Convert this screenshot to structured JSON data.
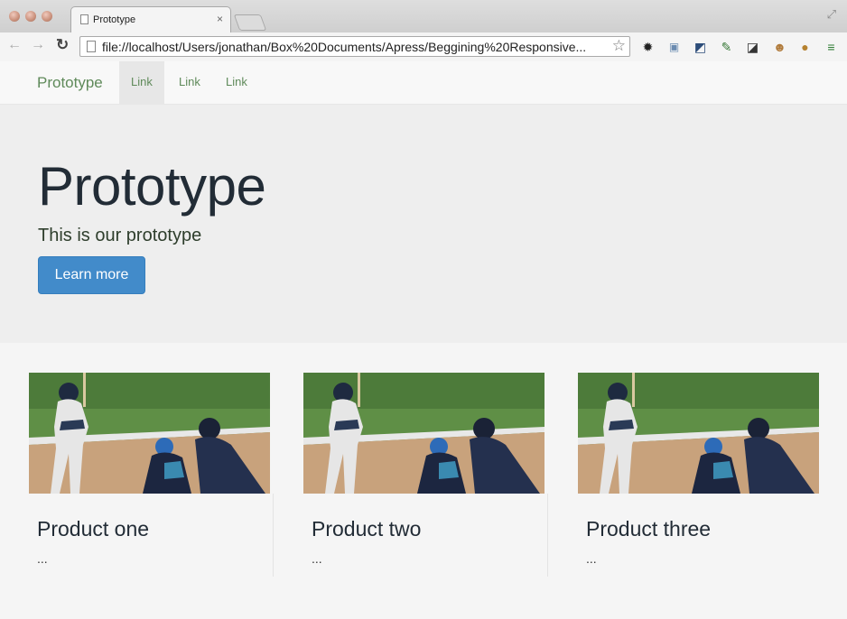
{
  "browser": {
    "tab_title": "Prototype",
    "tab_close": "×",
    "url": "file://localhost/Users/jonathan/Box%20Documents/Apress/Beggining%20Responsive...",
    "icons": [
      "back-arrow-icon",
      "forward-arrow-icon",
      "reload-icon",
      "star-icon",
      "gear-icon",
      "calendar-icon",
      "image-icon",
      "wrench-icon",
      "ruler-icon",
      "face-icon",
      "abp-icon",
      "menu-icon"
    ]
  },
  "navbar": {
    "brand": "Prototype",
    "links": [
      "Link",
      "Link",
      "Link"
    ]
  },
  "jumbotron": {
    "heading": "Prototype",
    "lead": "This is our prototype",
    "button": "Learn more",
    "button_color": "#428bca"
  },
  "products": [
    {
      "title": "Product one",
      "desc": "..."
    },
    {
      "title": "Product two",
      "desc": "..."
    },
    {
      "title": "Product three",
      "desc": "..."
    }
  ]
}
